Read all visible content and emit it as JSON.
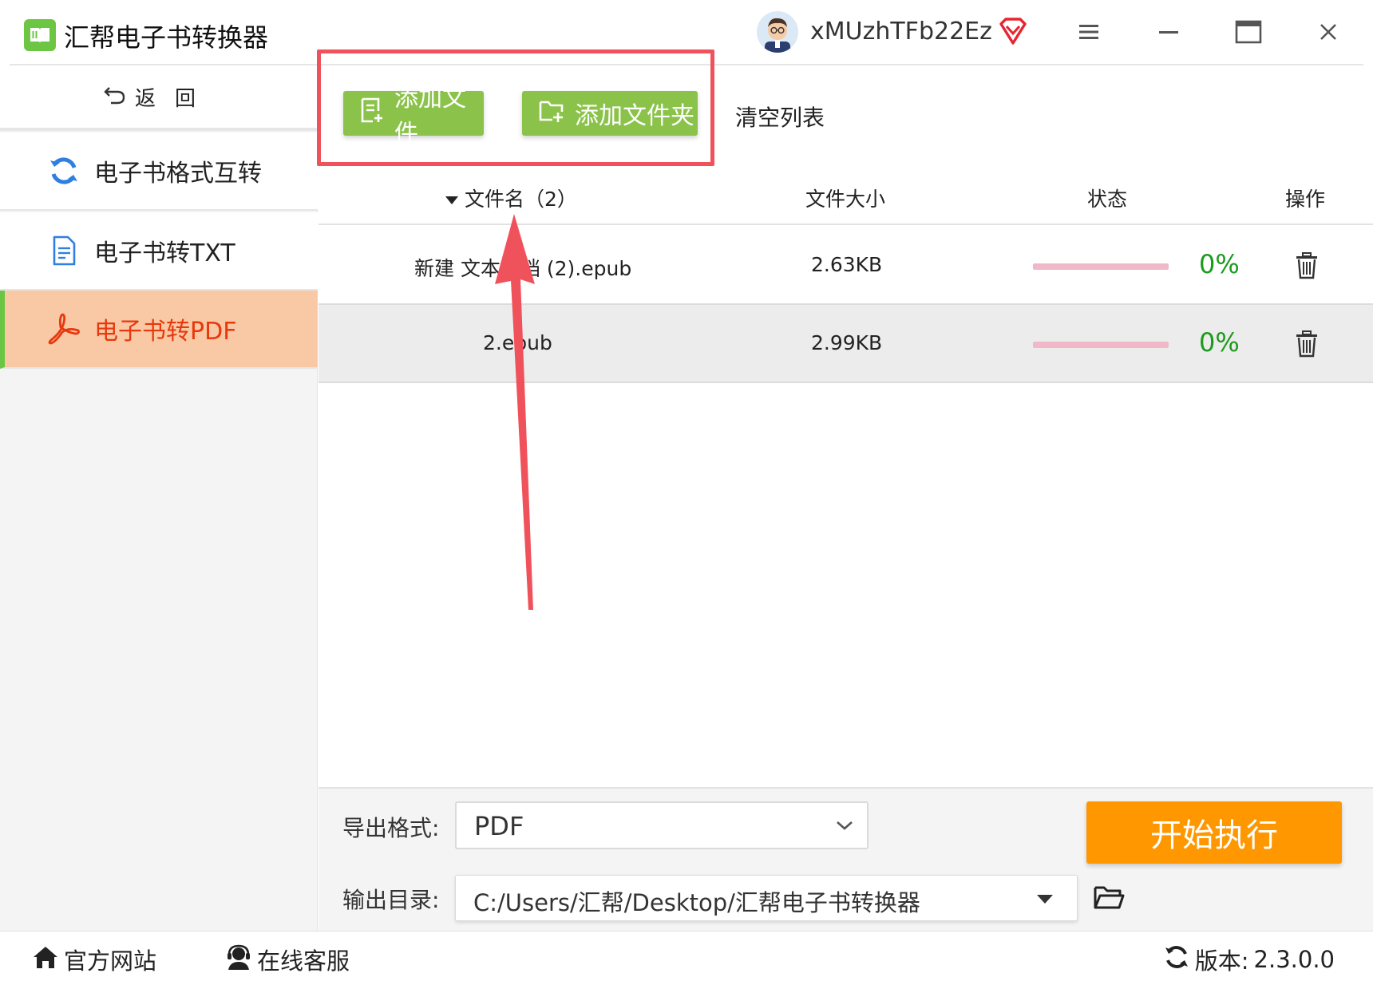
{
  "app": {
    "title": "汇帮电子书转换器",
    "username": "xMUzhTFb22Ez",
    "colors": {
      "accent_green": "#8bc34a",
      "orange": "#ff9800",
      "active_bg": "#f8c9a4",
      "active_text": "#e8380d",
      "highlight_red": "#f0525c"
    }
  },
  "window_controls": {
    "menu_icon": "hamburger-icon",
    "minimize_icon": "minimize-icon",
    "maximize_icon": "maximize-icon",
    "close_icon": "close-icon"
  },
  "sidebar": {
    "back_label": "返回",
    "items": [
      {
        "label": "电子书格式互转",
        "icon": "refresh-icon",
        "active": false
      },
      {
        "label": "电子书转TXT",
        "icon": "document-icon",
        "active": false
      },
      {
        "label": "电子书转PDF",
        "icon": "pdf-icon",
        "active": true
      }
    ]
  },
  "toolbar": {
    "add_file_label": "添加文件",
    "add_folder_label": "添加文件夹",
    "clear_list_label": "清空列表"
  },
  "table": {
    "headers": {
      "filename": "文件名（2）",
      "size": "文件大小",
      "status": "状态",
      "action": "操作"
    },
    "rows": [
      {
        "filename": "新建 文本文档 (2).epub",
        "size": "2.63KB",
        "progress_pct": 0,
        "status_text": "0%"
      },
      {
        "filename": "2.epub",
        "size": "2.99KB",
        "progress_pct": 0,
        "status_text": "0%"
      }
    ]
  },
  "settings": {
    "export_format_label": "导出格式:",
    "export_format_value": "PDF",
    "output_dir_label": "输出目录:",
    "output_dir_value": "C:/Users/汇帮/Desktop/汇帮电子书转换器",
    "start_label": "开始执行"
  },
  "footer": {
    "website_label": "官方网站",
    "support_label": "在线客服",
    "version_label": "版本:",
    "version_value": "2.3.0.0"
  }
}
